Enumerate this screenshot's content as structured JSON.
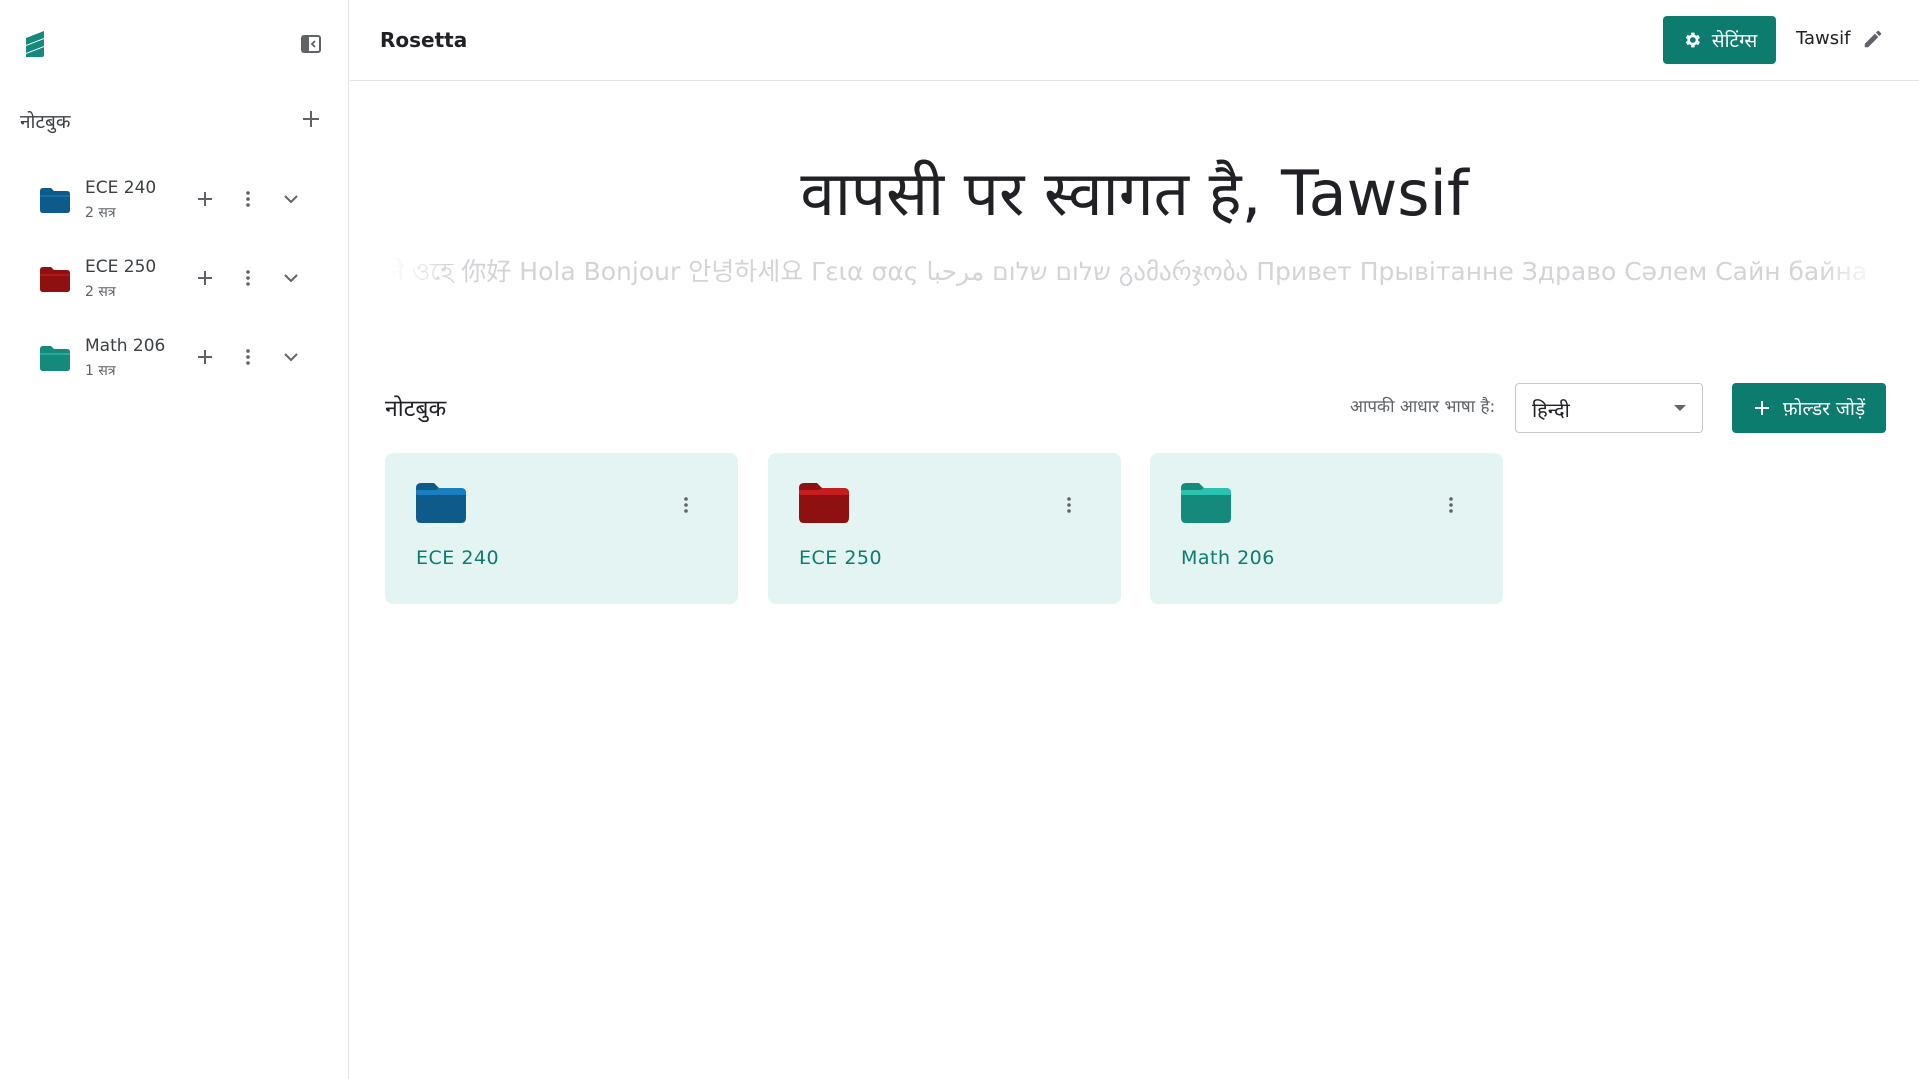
{
  "header": {
    "app_title": "Rosetta",
    "settings_label": "सेटिंग्स",
    "user_name": "Tawsif"
  },
  "sidebar": {
    "heading": "नोटबुक",
    "items": [
      {
        "title": "ECE 240",
        "subtitle": "2 सत्र",
        "color": "#0e5a8a"
      },
      {
        "title": "ECE 250",
        "subtitle": "2 सत्र",
        "color": "#8e1010"
      },
      {
        "title": "Math 206",
        "subtitle": "1 सत्र",
        "color": "#14897c"
      }
    ]
  },
  "main": {
    "welcome": "वापसी पर स्वागत है, Tawsif",
    "greetings": "ने ওহে 你好 Hola Bonjour 안녕하세요 Γεια σας שלום שלום مرحبا გამარჯობა Привет Прывітанне Здраво Сәлем Сайн байна уу Зд",
    "section_title": "नोटबुक",
    "language_label": "आपकी आधार भाषा है:",
    "language_value": "हिन्दी",
    "add_folder_label": "फ़ोल्डर जोड़ें",
    "cards": [
      {
        "title": "ECE 240",
        "color": "#0e5a8a"
      },
      {
        "title": "ECE 250",
        "color": "#8e1010"
      },
      {
        "title": "Math 206",
        "color": "#14897c"
      }
    ]
  },
  "colors": {
    "accent": "#0c7c6f",
    "card_bg": "#e3f4f2"
  }
}
